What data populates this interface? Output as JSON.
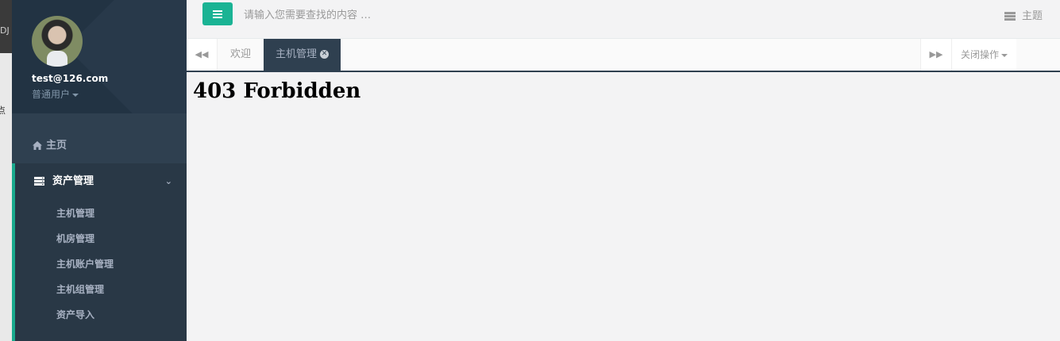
{
  "background_window": {
    "edge_text_1": "DJ",
    "edge_text_2": "点"
  },
  "sidebar": {
    "user_email": "test@126.com",
    "user_role": "普通用户",
    "home_label": "主页",
    "asset_menu": {
      "label": "资产管理",
      "items": [
        "主机管理",
        "机房管理",
        "主机账户管理",
        "主机组管理",
        "资产导入"
      ]
    }
  },
  "header": {
    "search_placeholder": "请输入您需要查找的内容 …",
    "theme_label": "主题"
  },
  "tabs": {
    "items": [
      {
        "label": "欢迎",
        "active": false
      },
      {
        "label": "主机管理",
        "active": true
      }
    ],
    "close_ops_label": "关闭操作"
  },
  "content": {
    "heading": "403 Forbidden"
  },
  "colors": {
    "accent": "#1ab394",
    "sidebar": "#2f4050",
    "sidebar_dark": "#293846"
  },
  "icons": [
    "menu-icon",
    "home-icon",
    "server-icon",
    "chevron-down-icon",
    "backward-icon",
    "forward-icon",
    "close-circle-icon",
    "theme-icon"
  ]
}
